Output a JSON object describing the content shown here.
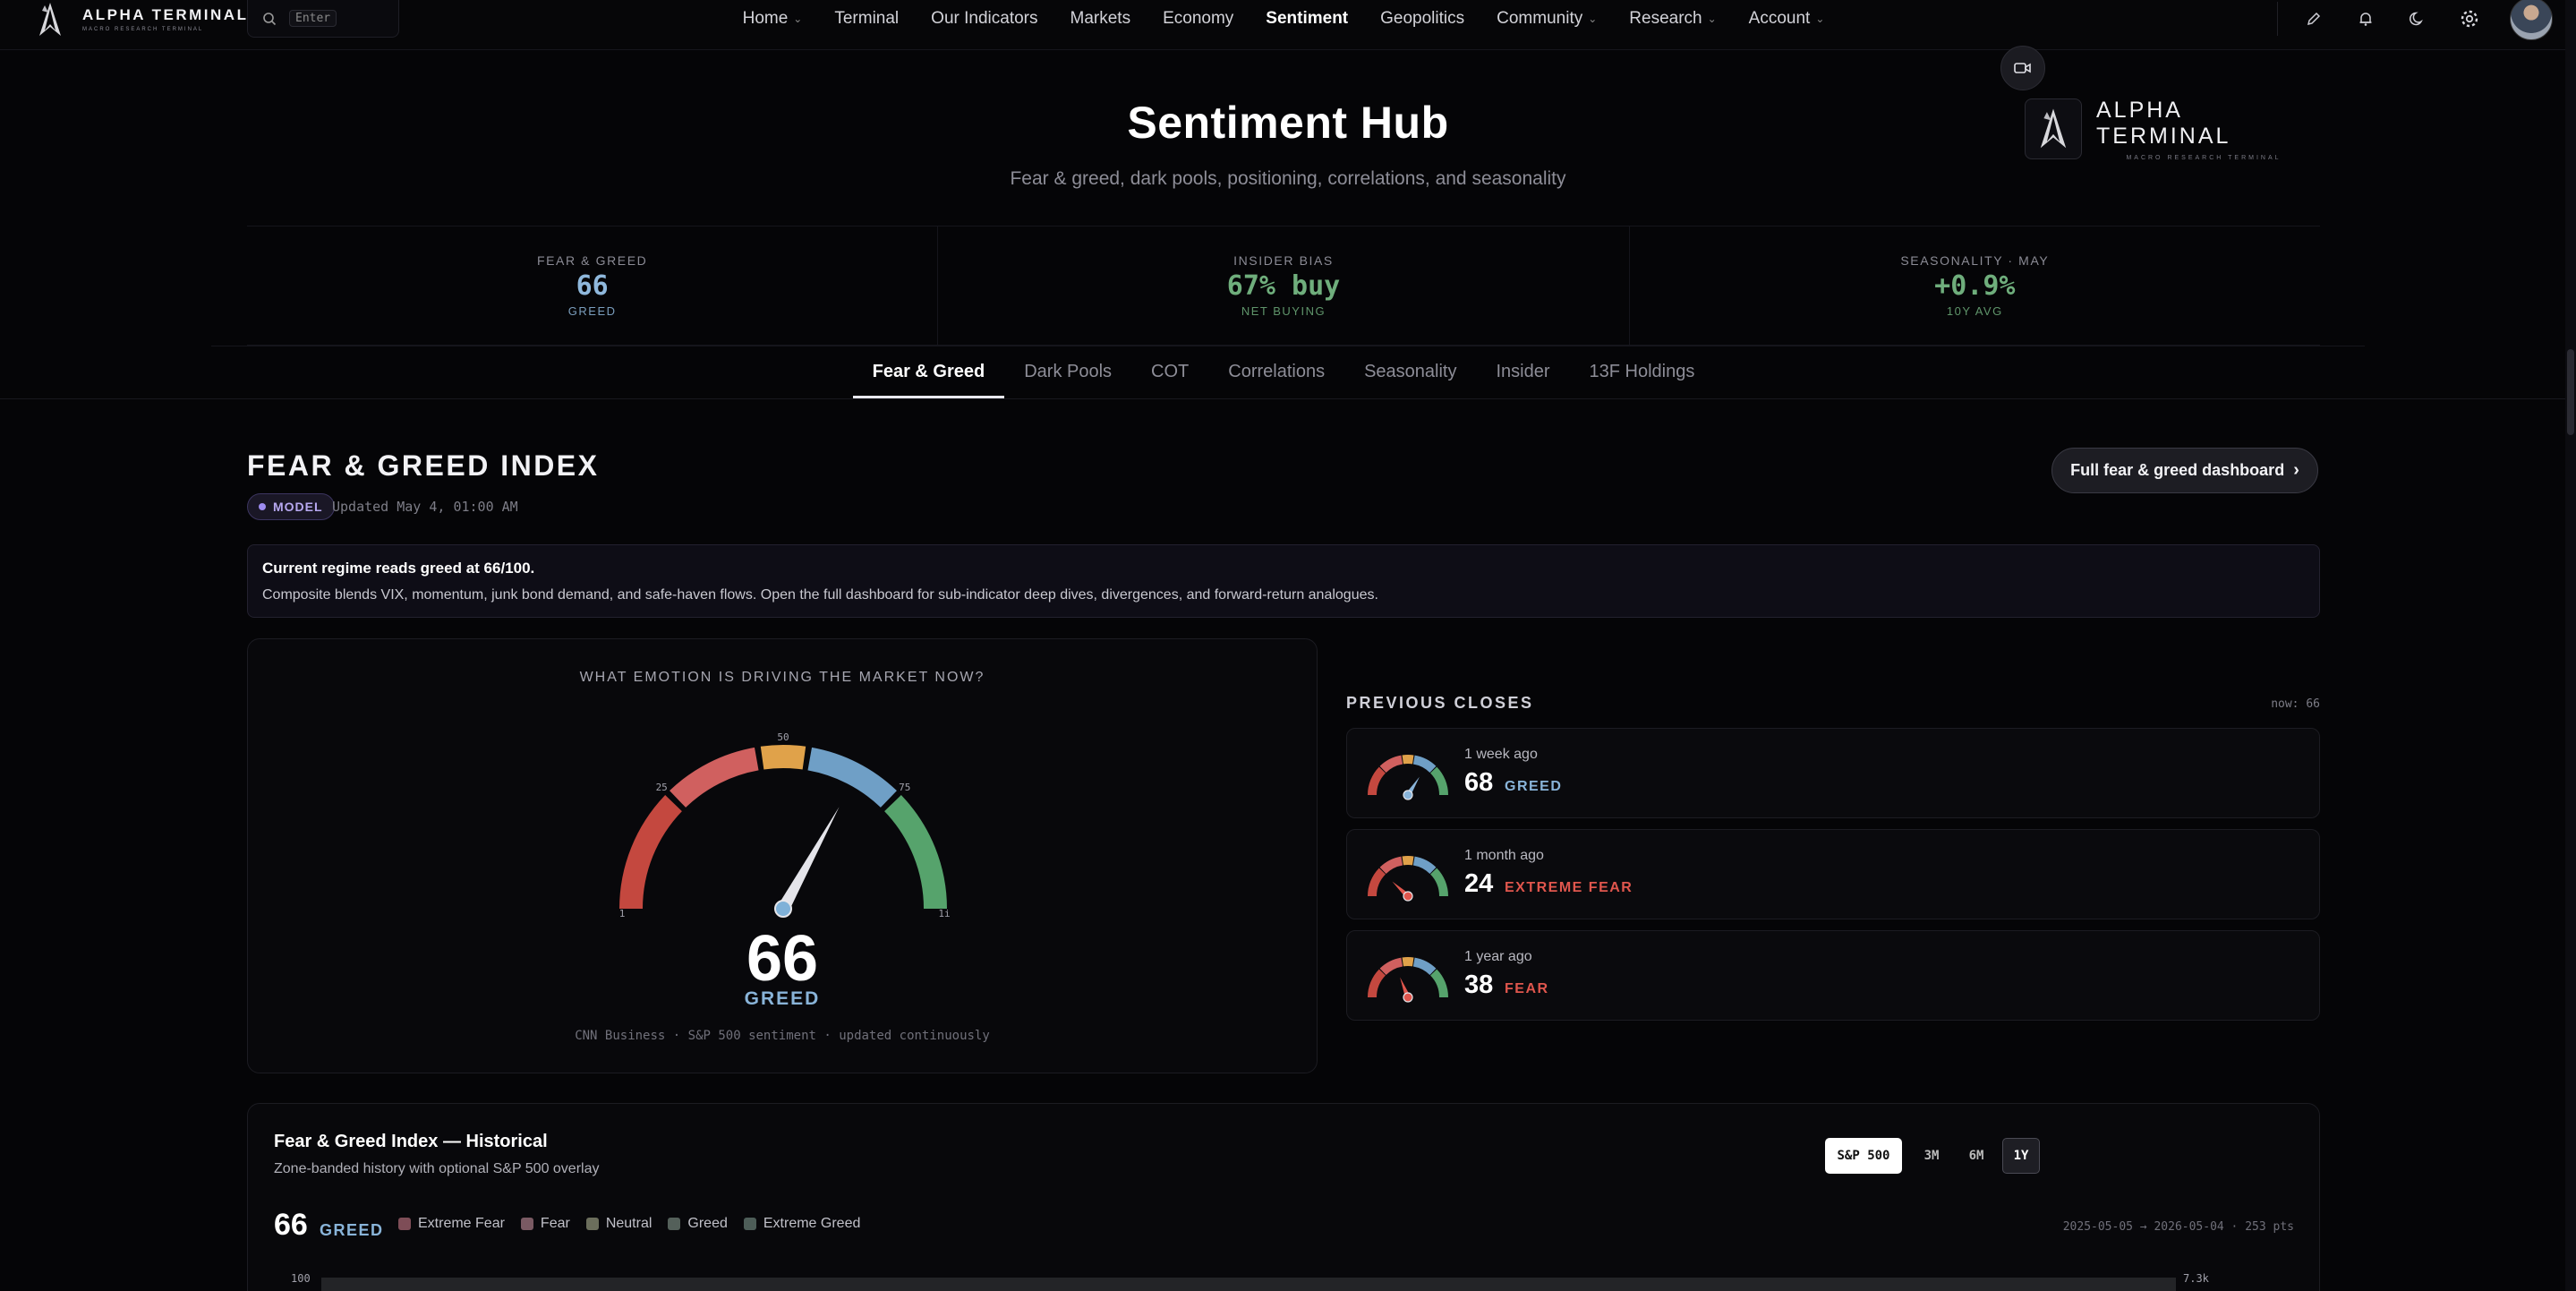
{
  "brand": {
    "title": "ALPHA TERMINAL",
    "subtitle": "MACRO RESEARCH TERMINAL"
  },
  "search": {
    "shortcut": "Enter"
  },
  "nav": {
    "items": [
      {
        "label": "Home",
        "dropdown": true
      },
      {
        "label": "Terminal",
        "dropdown": false
      },
      {
        "label": "Our Indicators",
        "dropdown": false
      },
      {
        "label": "Markets",
        "dropdown": false
      },
      {
        "label": "Economy",
        "dropdown": false
      },
      {
        "label": "Sentiment",
        "dropdown": false,
        "active": true
      },
      {
        "label": "Geopolitics",
        "dropdown": false
      },
      {
        "label": "Community",
        "dropdown": true
      },
      {
        "label": "Research",
        "dropdown": true
      },
      {
        "label": "Account",
        "dropdown": true
      }
    ],
    "icons": [
      "edit-icon",
      "bell-icon",
      "moon-icon",
      "gear-icon"
    ]
  },
  "hero": {
    "title": "Sentiment Hub",
    "subtitle": "Fear & greed, dark pools, positioning, correlations, and seasonality"
  },
  "stats": [
    {
      "label": "FEAR & GREED",
      "value": "66",
      "caption": "GREED",
      "color": "#8fb8dc"
    },
    {
      "label": "INSIDER BIAS",
      "value": "67% buy",
      "caption": "NET BUYING",
      "color": "#6fae7c"
    },
    {
      "label": "SEASONALITY · MAY",
      "value": "+0.9%",
      "caption": "10Y AVG",
      "color": "#6fae7c"
    }
  ],
  "tabs": [
    {
      "label": "Fear & Greed",
      "active": true
    },
    {
      "label": "Dark Pools"
    },
    {
      "label": "COT"
    },
    {
      "label": "Correlations"
    },
    {
      "label": "Seasonality"
    },
    {
      "label": "Insider"
    },
    {
      "label": "13F Holdings"
    }
  ],
  "section": {
    "title": "FEAR & GREED INDEX",
    "badge": "MODEL",
    "updated": "Updated May 4, 01:00 AM",
    "dashboard_button": "Full fear & greed dashboard"
  },
  "note": {
    "title": "Current regime reads greed at 66/100.",
    "body": "Composite blends VIX, momentum, junk bond demand, and safe-haven flows. Open the full dashboard for sub-indicator deep dives, divergences, and forward-return analogues."
  },
  "gauge": {
    "question": "WHAT EMOTION IS DRIVING THE MARKET NOW?",
    "value": 66,
    "value_text": "66",
    "label": "GREED",
    "footer": "CNN Business · S&P 500 sentiment · updated continuously",
    "ticks": {
      "t0": "1",
      "t25": "25",
      "t50": "50",
      "t75": "75",
      "t100": "1i"
    },
    "zone_colors": [
      "#c4483f",
      "#d0605f",
      "#e0a24a",
      "#6f9fc6",
      "#56a36c"
    ]
  },
  "previous": {
    "title": "PREVIOUS CLOSES",
    "now": "now: 66",
    "rows": [
      {
        "when": "1 week ago",
        "value": 68,
        "value_text": "68",
        "label": "GREED",
        "color": "#89b4d9"
      },
      {
        "when": "1 month ago",
        "value": 24,
        "value_text": "24",
        "label": "EXTREME FEAR",
        "color": "#e0564d"
      },
      {
        "when": "1 year ago",
        "value": 38,
        "value_text": "38",
        "label": "FEAR",
        "color": "#e0564d"
      }
    ]
  },
  "historical": {
    "title": "Fear & Greed Index — Historical",
    "subtitle": "Zone-banded history with optional S&P 500 overlay",
    "value_text": "66",
    "label": "GREED",
    "buttons": [
      {
        "label": "S&P 500",
        "active": true
      },
      {
        "label": "3M"
      },
      {
        "label": "6M"
      },
      {
        "label": "1Y",
        "selected": true
      }
    ],
    "legend": [
      {
        "label": "Extreme Fear",
        "color": "#7e4d57"
      },
      {
        "label": "Fear",
        "color": "#7a5a63"
      },
      {
        "label": "Neutral",
        "color": "#6b6e5c"
      },
      {
        "label": "Greed",
        "color": "#54605a"
      },
      {
        "label": "Extreme Greed",
        "color": "#4d5d58"
      }
    ],
    "range": "2025-05-05 → 2026-05-04 · 253 pts",
    "y_top": "100",
    "y_right_top": "7.3k"
  }
}
